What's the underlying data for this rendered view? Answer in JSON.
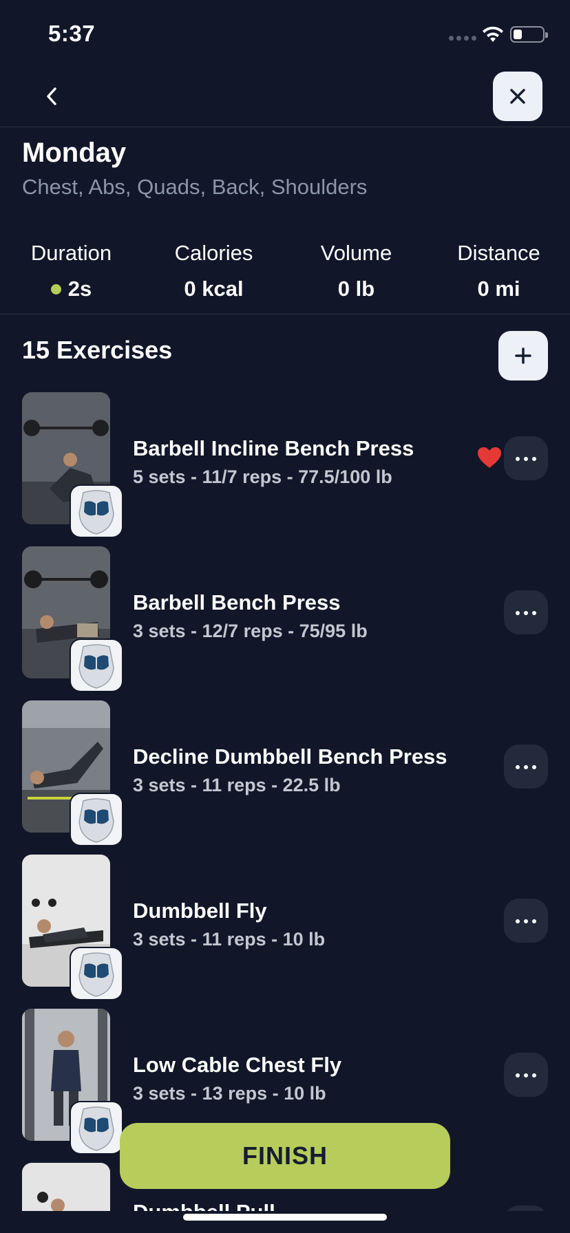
{
  "status_bar": {
    "time": "5:37"
  },
  "workout": {
    "title": "Monday",
    "muscles": "Chest, Abs, Quads, Back, Shoulders"
  },
  "stats": [
    {
      "label": "Duration",
      "value": "2s",
      "live": true
    },
    {
      "label": "Calories",
      "value": "0 kcal"
    },
    {
      "label": "Volume",
      "value": "0 lb"
    },
    {
      "label": "Distance",
      "value": "0 mi"
    }
  ],
  "exercises_header": "15 Exercises",
  "exercises": [
    {
      "name": "Barbell Incline Bench Press",
      "detail": "5 sets - 11/7 reps - 77.5/100 lb",
      "favorite": true
    },
    {
      "name": "Barbell Bench Press",
      "detail": "3 sets - 12/7 reps - 75/95 lb",
      "favorite": false
    },
    {
      "name": "Decline Dumbbell Bench Press",
      "detail": "3 sets - 11 reps - 22.5 lb",
      "favorite": false
    },
    {
      "name": "Dumbbell Fly",
      "detail": "3 sets - 11 reps - 10 lb",
      "favorite": false
    },
    {
      "name": "Low Cable Chest Fly",
      "detail": "3 sets - 13 reps - 10 lb",
      "favorite": false
    }
  ],
  "peek_exercise_name": "Dumbbell Pull",
  "finish_label": "FINISH",
  "colors": {
    "background": "#111729",
    "accent": "#b7cc5a",
    "favorite": "#e53935"
  }
}
